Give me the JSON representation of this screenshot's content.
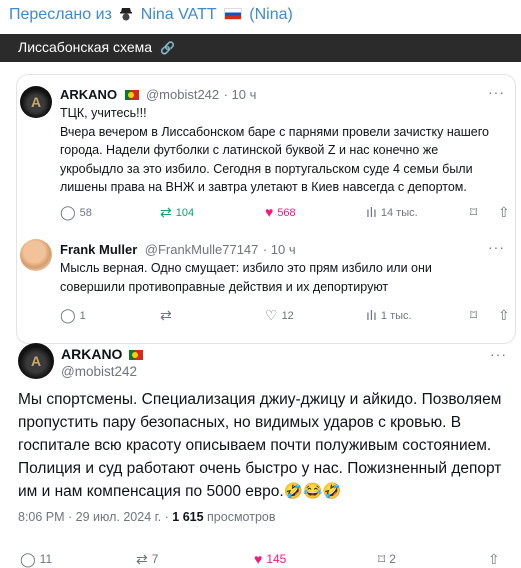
{
  "forward": {
    "prefix": "Переслано из",
    "channel": "Nina VATT",
    "alias": "(Nina)"
  },
  "topbar": {
    "title": "Лиссабонская схема"
  },
  "tweet1": {
    "name": "ARKANO",
    "handle": "@mobist242",
    "time": "· 10 ч",
    "text": "ТЦК, учитесь!!!\nВчера вечером в Лиссабонском баре с парнями провели зачистку нашего города. Надели футболки с латинской буквой Z и нас конечно же укробыдло за это избило. Сегодня в португальском суде  4 семьи были лишены права на ВНЖ и завтра улетают в Киев навсегда с депортом.",
    "replies": "58",
    "reposts": "104",
    "likes": "568",
    "views": "14 тыс."
  },
  "tweet2": {
    "name": "Frank Muller",
    "handle": "@FrankMulle77147",
    "time": "· 10 ч",
    "text": "Мысль верная. Одно смущает: избило это прям избило или они совершили противоправные действия и их депортируют",
    "replies": "1",
    "reposts": "",
    "likes": "12",
    "views": "1 тыс."
  },
  "main": {
    "name": "ARKANO",
    "handle": "@mobist242",
    "text": "Мы спортсмены. Специализация джиу-джицу и айкидо. Позволяем пропустить пару безопасных, но видимых ударов с кровью. В госпитале всю красоту описываем почти полуживым состоянием. Полиция и суд работают очень быстро у нас. Пожизненный депорт им и нам компенсация по 5000 евро.🤣😂🤣",
    "date": "8:06 PM · 29 июл. 2024 г. ·",
    "views_count": "1 615",
    "views_label": "просмотров",
    "replies": "11",
    "reposts": "7",
    "likes": "145",
    "bookmarks": "2"
  },
  "colors": {
    "link": "#3e8ad4",
    "repost": "#00a86b",
    "like": "#f91880",
    "muted": "#6e767d"
  },
  "icons": {
    "reply": "comment-icon",
    "repost": "repost-icon",
    "like": "heart-icon",
    "views": "bar-chart-icon",
    "bookmark": "bookmark-icon",
    "share": "share-icon",
    "more": "ellipsis-icon",
    "link": "link-icon"
  }
}
